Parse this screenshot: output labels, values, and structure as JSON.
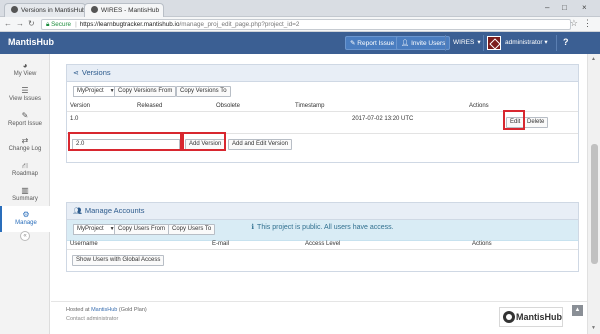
{
  "browser": {
    "tabs": [
      {
        "title": "Versions in MantisHub",
        "close": "×"
      },
      {
        "title": "WIRES - MantisHub",
        "close": "×"
      }
    ],
    "window_controls": {
      "minimize": "–",
      "maximize": "□",
      "close": "×"
    },
    "nav": {
      "back": "←",
      "forward": "→",
      "reload": "↻"
    },
    "address": {
      "secure_label": "Secure",
      "host": "https://learnbugtracker.mantishub.io",
      "path": "/manage_proj_edit_page.php?project_id=2"
    }
  },
  "navbar": {
    "brand": "MantisHub",
    "report_issue": "Report Issue",
    "invite_users": "Invite Users",
    "project": "WIRES",
    "user": "administrator",
    "help": "?"
  },
  "sidebar": {
    "items": [
      {
        "label": "My View",
        "icon": "dashboard-icon"
      },
      {
        "label": "View Issues",
        "icon": "list-icon"
      },
      {
        "label": "Report Issue",
        "icon": "edit-icon"
      },
      {
        "label": "Change Log",
        "icon": "retweet-icon"
      },
      {
        "label": "Roadmap",
        "icon": "road-icon"
      },
      {
        "label": "Summary",
        "icon": "bar-chart-icon"
      },
      {
        "label": "Manage",
        "icon": "gears-icon"
      }
    ],
    "collapse": "«"
  },
  "versions": {
    "title": "Versions",
    "project_select": "MyProject",
    "copy_from": "Copy Versions From",
    "copy_to": "Copy Versions To",
    "columns": [
      "Version",
      "Released",
      "Obsolete",
      "Timestamp",
      "Actions"
    ],
    "rows": [
      {
        "version": "1.0",
        "released": "",
        "obsolete": "",
        "timestamp": "2017-07-02 13:20 UTC",
        "edit": "Edit",
        "delete": "Delete"
      }
    ],
    "new_version_value": "2.0",
    "add_version": "Add Version",
    "add_and_edit": "Add and Edit Version"
  },
  "notice": {
    "text": "This project is public. All users have access."
  },
  "accounts": {
    "title": "Manage Accounts",
    "project_select": "MyProject",
    "copy_from": "Copy Users From",
    "copy_to": "Copy Users To",
    "columns": [
      "Username",
      "E-mail",
      "Access Level",
      "Actions"
    ],
    "show_global": "Show Users with Global Access"
  },
  "footer": {
    "hosted_prefix": "Hosted at",
    "hosted_link": "MantisHub",
    "hosted_plan": "(Gold Plan)",
    "contact": "Contact administrator",
    "logo": "MantisHub",
    "to_top": "▲"
  },
  "colors": {
    "navbar": "#3b5f93",
    "highlight": "#d8272f",
    "notice_bg": "#d9ecf5",
    "active": "#2a6ebb"
  }
}
